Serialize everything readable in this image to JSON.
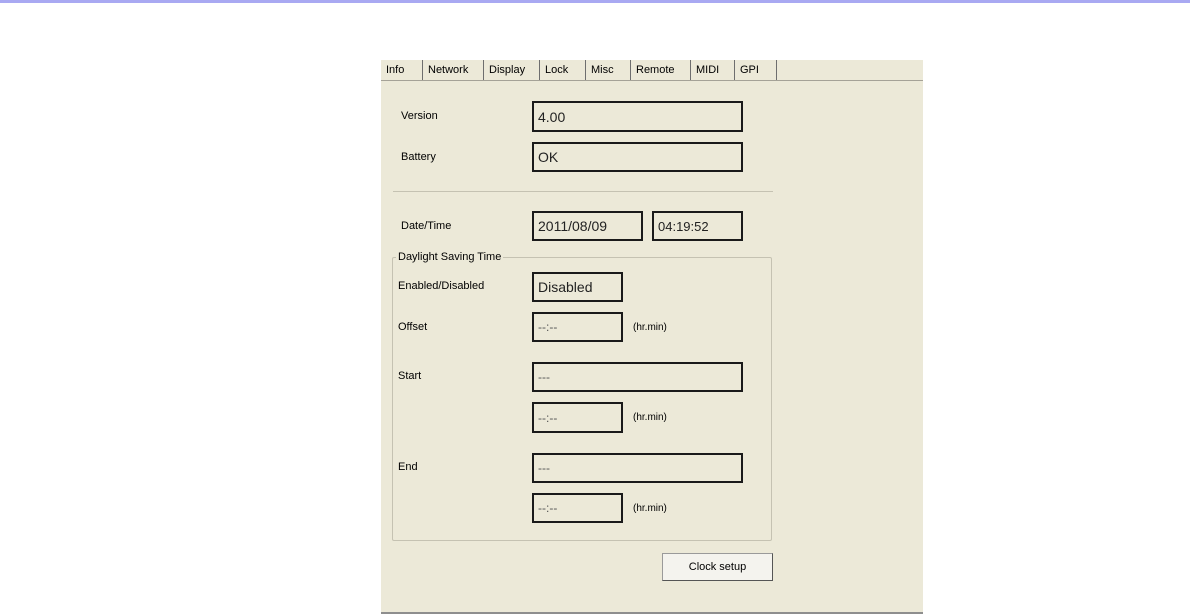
{
  "tabs": [
    "Info",
    "Network",
    "Display",
    "Lock",
    "Misc",
    "Remote",
    "MIDI",
    "GPI"
  ],
  "info": {
    "version_label": "Version",
    "version_value": "4.00",
    "battery_label": "Battery",
    "battery_value": "OK",
    "datetime_label": "Date/Time",
    "date_value": "2011/08/09",
    "time_value": "04:19:52"
  },
  "dst": {
    "group_title": "Daylight Saving Time",
    "enabled_label": "Enabled/Disabled",
    "enabled_value": "Disabled",
    "offset_label": "Offset",
    "offset_value": "--:--",
    "offset_unit": "(hr.min)",
    "start_label": "Start",
    "start_date_value": "---",
    "start_time_value": "--:--",
    "start_unit": "(hr.min)",
    "end_label": "End",
    "end_date_value": "---",
    "end_time_value": "--:--",
    "end_unit": "(hr.min)"
  },
  "buttons": {
    "clock_setup": "Clock setup"
  }
}
